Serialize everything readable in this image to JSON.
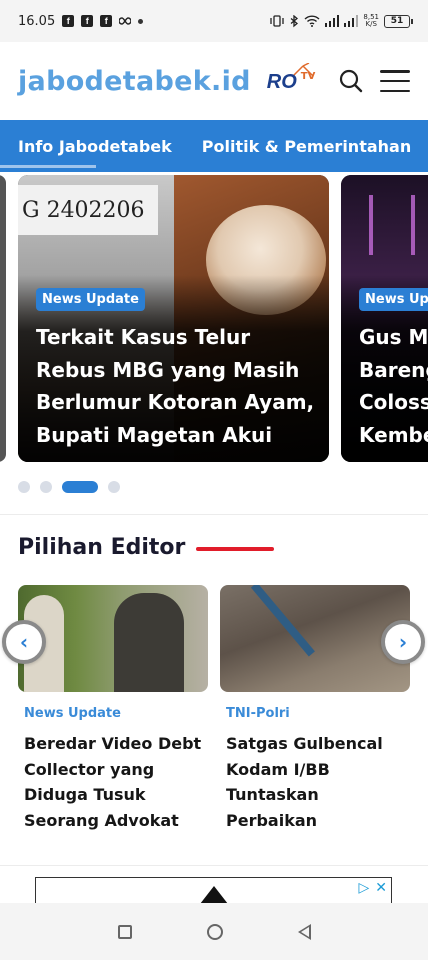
{
  "status_bar": {
    "time": "16.05",
    "battery": "51",
    "speed_value": "8,51",
    "speed_unit": "K/S"
  },
  "header": {
    "logo": "jabodetabek.id",
    "partner_logo_text": "RO",
    "partner_logo_sub": "TV"
  },
  "nav": {
    "items": [
      "Info Jabodetabek",
      "Politik & Pemerintahan"
    ]
  },
  "slider": {
    "cards": [
      {
        "category": "News Update",
        "title": "Terkait Kasus Telur Rebus MBG yang Masih Berlumur Kotoran Ayam, Bupati Magetan Akui",
        "image_text": "G 2402206"
      },
      {
        "category": "News Upd",
        "title_lines": [
          "Gus Mi",
          "Bareng",
          "Coloss",
          "Kembe"
        ]
      }
    ],
    "dots": {
      "total": 4,
      "active_index": 2
    }
  },
  "editor": {
    "heading": "Pilihan Editor",
    "cards": [
      {
        "category": "News Update",
        "title": "Beredar Video Debt Collector yang Diduga Tusuk Seorang Advokat"
      },
      {
        "category": "TNI-Polri",
        "title": "Satgas Gulbencal Kodam I/BB Tuntaskan Perbaikan"
      }
    ],
    "prev_arrow": "‹",
    "next_arrow": "›"
  },
  "ad": {
    "choices_icon": "▷",
    "close_icon": "✕"
  },
  "colors": {
    "brand_blue": "#2b7fd4",
    "logo_blue": "#5aa1df",
    "accent_red": "#e11d2a",
    "category_blue": "#3a8bd8"
  }
}
